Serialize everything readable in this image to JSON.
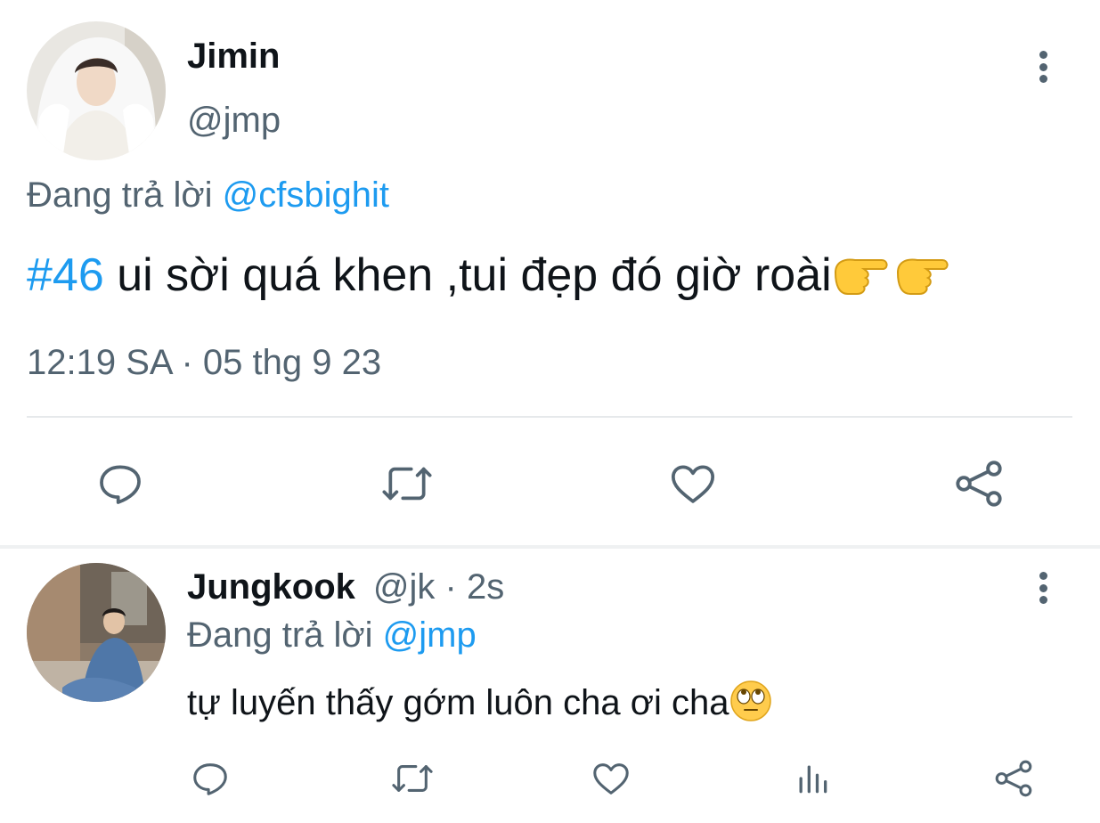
{
  "main_tweet": {
    "author_name": "Jimin",
    "author_handle": "@jmp",
    "reply_prefix": "Đang trả lời",
    "reply_to": "@cfsbighit",
    "hashtag": "#46",
    "text": " ui sời quá khen ,tui đẹp đó giờ roài",
    "emojis": [
      "backhand-index-pointing-right-emoji",
      "backhand-index-pointing-right-emoji"
    ],
    "timestamp": "12:19 SA · 05 thg 9 23",
    "actions": [
      "reply-icon",
      "retweet-icon",
      "like-icon",
      "share-icon"
    ]
  },
  "reply_tweet": {
    "author_name": "Jungkook",
    "author_meta": "@jk · 2s",
    "reply_prefix": "Đang trả lời",
    "reply_to": "@jmp",
    "text": "tự luyến thấy gớm luôn cha ơi cha",
    "emoji": "face-with-rolling-eyes-emoji",
    "actions": [
      "reply-icon",
      "retweet-icon",
      "like-icon",
      "views-icon",
      "share-icon"
    ]
  },
  "colors": {
    "link_blue": "#1d9bf0",
    "text_primary": "#0f1419",
    "text_secondary": "#536471",
    "divider": "#e6e9eb"
  }
}
